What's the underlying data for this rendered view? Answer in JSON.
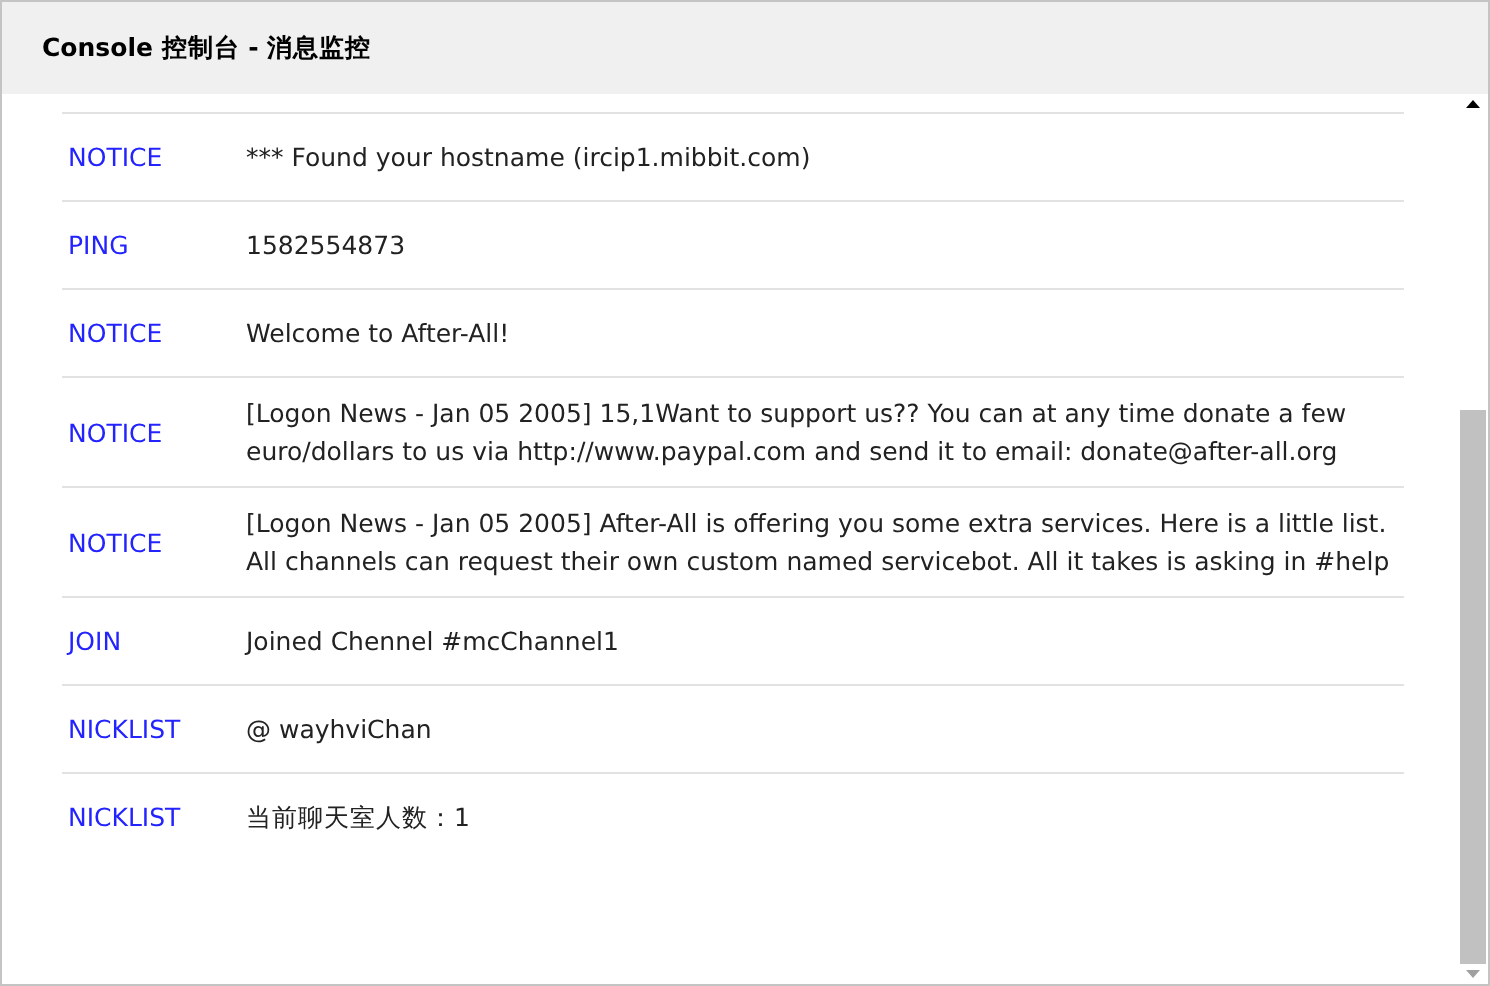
{
  "window": {
    "title": "Console 控制台 - 消息监控"
  },
  "messages": [
    {
      "type": "NOTICE",
      "text": "*** Found your hostname (ircip1.mibbit.com)"
    },
    {
      "type": "PING",
      "text": "1582554873"
    },
    {
      "type": "NOTICE",
      "text": "Welcome to After-All!"
    },
    {
      "type": "NOTICE",
      "text": "[Logon News - Jan 05 2005] 15,1Want to support us?? You can at any time donate a few euro/dollars to us via http://www.paypal.com and send it to email: donate@after-all.org"
    },
    {
      "type": "NOTICE",
      "text": "[Logon News - Jan 05 2005] After-All is offering you some extra services. Here is a little list. All channels can request their own custom named servicebot. All it takes is asking in #help"
    },
    {
      "type": "JOIN",
      "text": "Joined Chennel #mcChannel1"
    },
    {
      "type": "NICKLIST",
      "text": "@ wayhviChan"
    },
    {
      "type": "NICKLIST",
      "text": "当前聊天室人数：1"
    }
  ]
}
